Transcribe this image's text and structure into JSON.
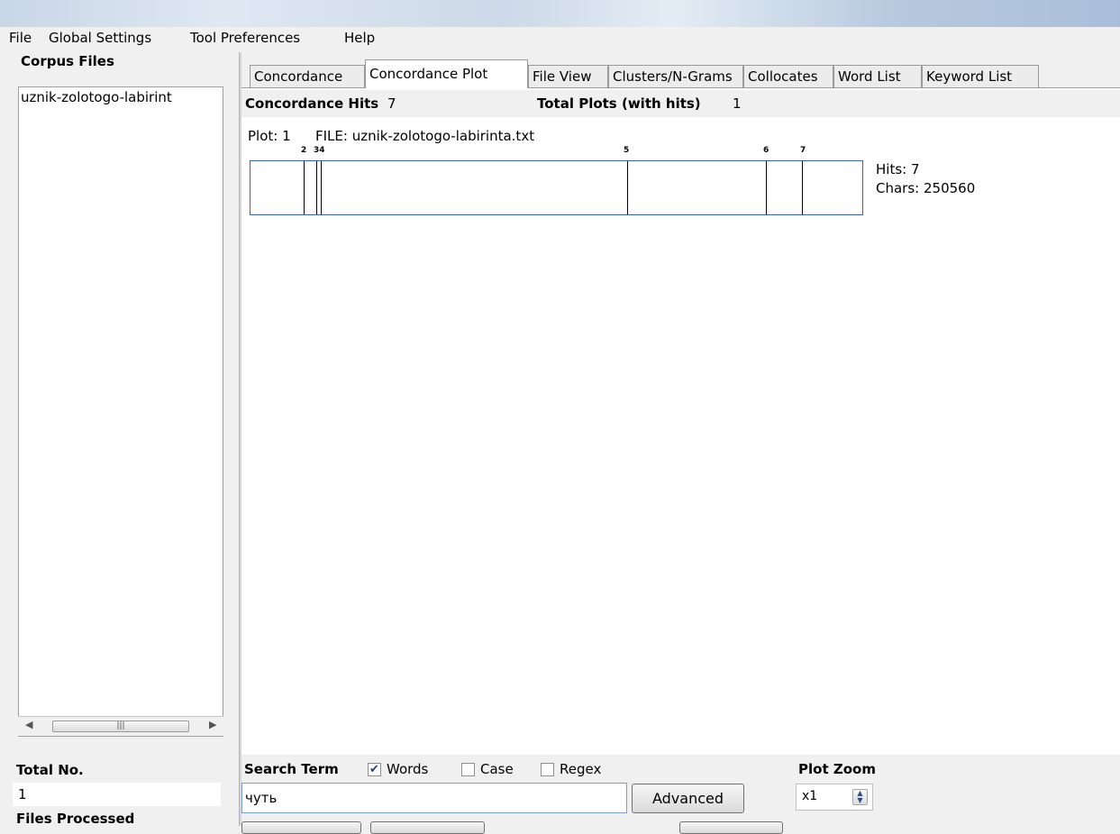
{
  "menu": {
    "items": [
      "File",
      "Global Settings",
      "Tool Preferences",
      "Help"
    ]
  },
  "left_panel": {
    "corpus_heading": "Corpus Files",
    "files": [
      "uznik-zolotogo-labirint"
    ],
    "total_label": "Total No.",
    "total_value": "1",
    "processed_label": "Files Processed"
  },
  "tabs": {
    "items": [
      "Concordance",
      "Concordance Plot",
      "File View",
      "Clusters/N-Grams",
      "Collocates",
      "Word List",
      "Keyword List"
    ],
    "active": "Concordance Plot"
  },
  "plot": {
    "hits_label": "Concordance Hits",
    "hits_value": "7",
    "plots_label": "Total Plots (with hits)",
    "plots_value": "1",
    "plot_label": "Plot: 1",
    "file_label": "FILE: uznik-zolotogo-labirinta.txt",
    "hits_summary": "Hits: 7",
    "chars_summary": "Chars: 250560",
    "total_chars": 250560,
    "hit_numbers": [
      "2",
      "34",
      "5",
      "6",
      "7"
    ],
    "hit_positions": [
      0.087,
      0.108,
      0.115,
      0.615,
      0.842,
      0.902
    ]
  },
  "search": {
    "label": "Search Term",
    "words_label": "Words",
    "words_checked": true,
    "case_label": "Case",
    "case_checked": false,
    "regex_label": "Regex",
    "regex_checked": false,
    "value": "чуть",
    "advanced_label": "Advanced"
  },
  "zoom": {
    "label": "Plot Zoom",
    "value": "x1"
  },
  "colors": {
    "plot_border": "#3a5bd9",
    "selection": "#3399ff"
  }
}
